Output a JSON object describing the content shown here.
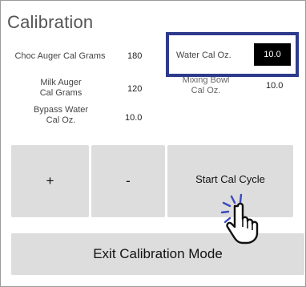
{
  "screen": {
    "title": "Calibration"
  },
  "fields": {
    "choc_auger": {
      "label": "Choc Auger Cal Grams",
      "value": "180"
    },
    "milk_auger": {
      "label": "Milk Auger Cal Grams",
      "value": "120"
    },
    "bypass_water": {
      "label": "Bypass Water Cal Oz.",
      "value": "10.0"
    },
    "mixing_bowl": {
      "label": "Mixing Bowl Cal Oz.",
      "value": "10.0"
    },
    "water": {
      "label": "Water Cal Oz.",
      "value": "10.0"
    }
  },
  "buttons": {
    "plus": "+",
    "minus": "-",
    "start_cal_cycle": "Start Cal Cycle",
    "exit_calibration": "Exit Calibration Mode"
  },
  "annotation": {
    "highlight_color": "#2e3a8c",
    "cursor": "pointing-hand-icon"
  }
}
